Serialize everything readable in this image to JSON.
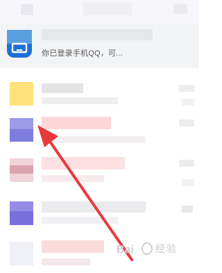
{
  "device_notice": {
    "text": "你已登录手机QQ，可..."
  },
  "watermark": {
    "brand": "经验",
    "logo_text": "Bai"
  },
  "colors": {
    "arrow": "#e8383d",
    "device_icon": "#1f6fd6"
  }
}
